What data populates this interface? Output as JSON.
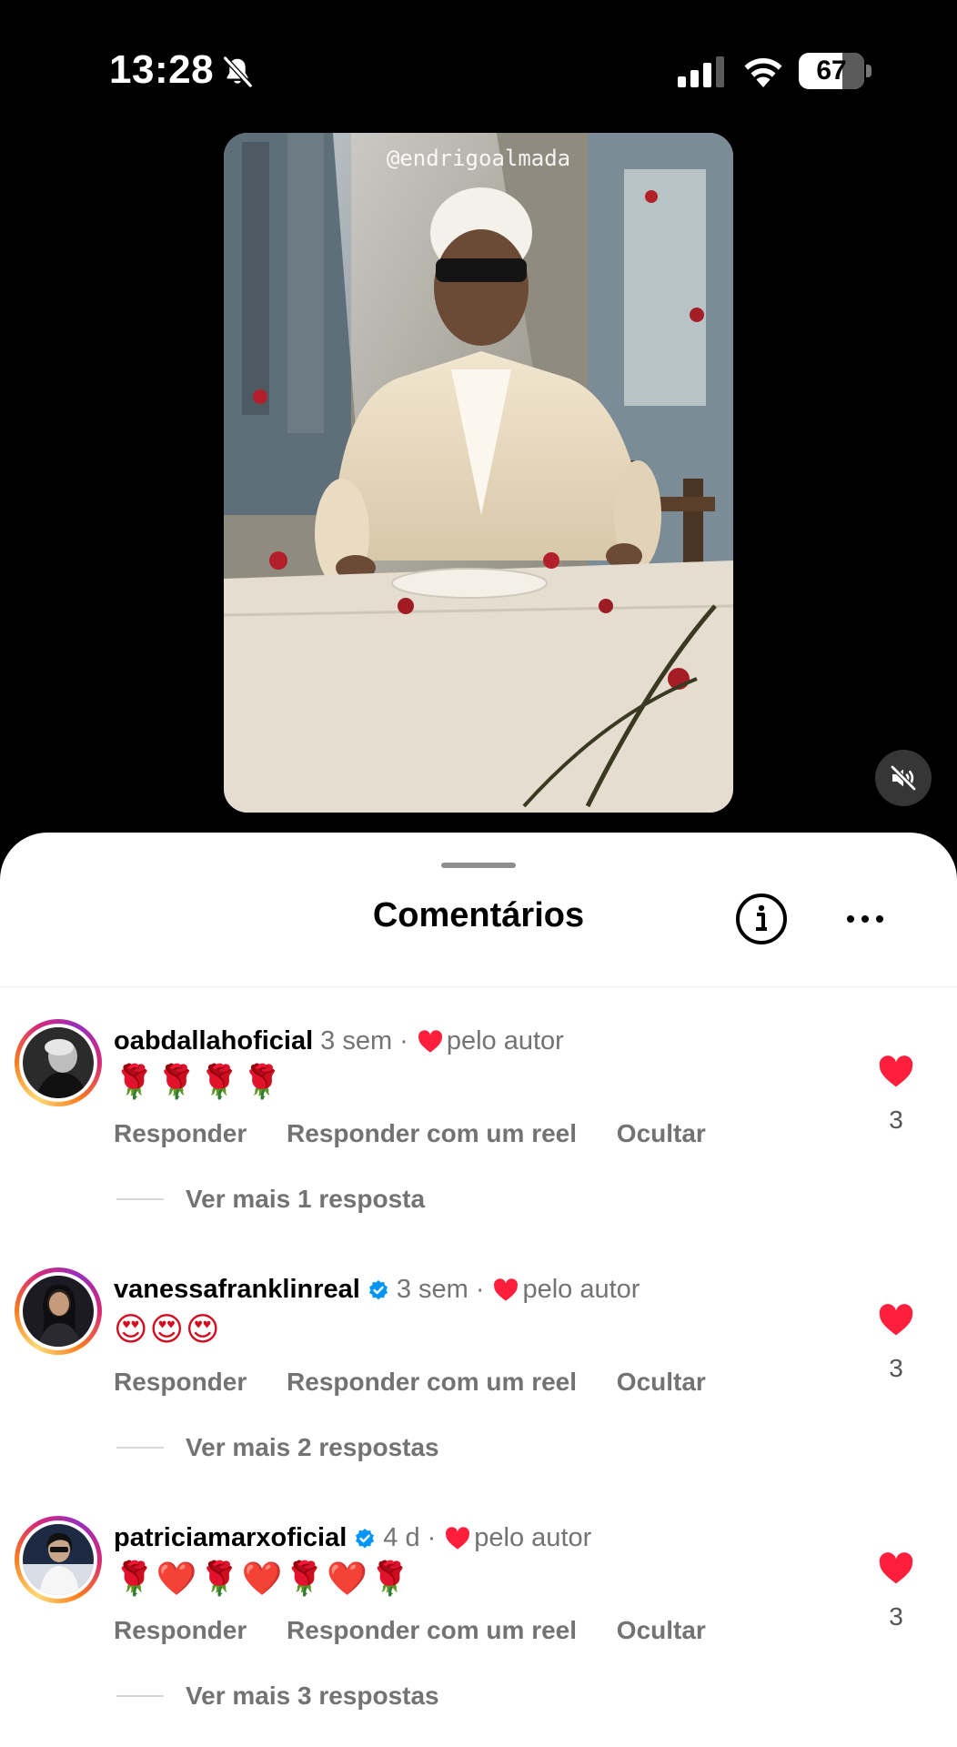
{
  "status_bar": {
    "time": "13:28",
    "battery_percent": 67,
    "battery_label": "67"
  },
  "video": {
    "watermark": "@endrigoalmada"
  },
  "sheet": {
    "title": "Comentários"
  },
  "comments": [
    {
      "username": "oabdallahoficial",
      "verified": false,
      "time": "3 sem",
      "separator": "·",
      "liked_by_author_label": "pelo autor",
      "text": "🌹🌹🌹🌹",
      "reply_label": "Responder",
      "reply_reel_label": "Responder com um reel",
      "hide_label": "Ocultar",
      "view_replies": "Ver mais 1 resposta",
      "likes": "3"
    },
    {
      "username": "vanessafranklinreal",
      "verified": true,
      "time": "3 sem",
      "separator": "·",
      "liked_by_author_label": "pelo autor",
      "text": "😍😍😍",
      "reply_label": "Responder",
      "reply_reel_label": "Responder com um reel",
      "hide_label": "Ocultar",
      "view_replies": "Ver mais 2 respostas",
      "likes": "3"
    },
    {
      "username": "patriciamarxoficial",
      "verified": true,
      "time": "4 d",
      "separator": "·",
      "liked_by_author_label": "pelo autor",
      "text": "🌹❤️🌹❤️🌹❤️🌹",
      "reply_label": "Responder",
      "reply_reel_label": "Responder com um reel",
      "hide_label": "Ocultar",
      "view_replies": "Ver mais 3 respostas",
      "likes": "3"
    }
  ],
  "colors": {
    "like_red": "#ff3040",
    "verified_blue": "#0095f6",
    "secondary_text": "#737373"
  }
}
